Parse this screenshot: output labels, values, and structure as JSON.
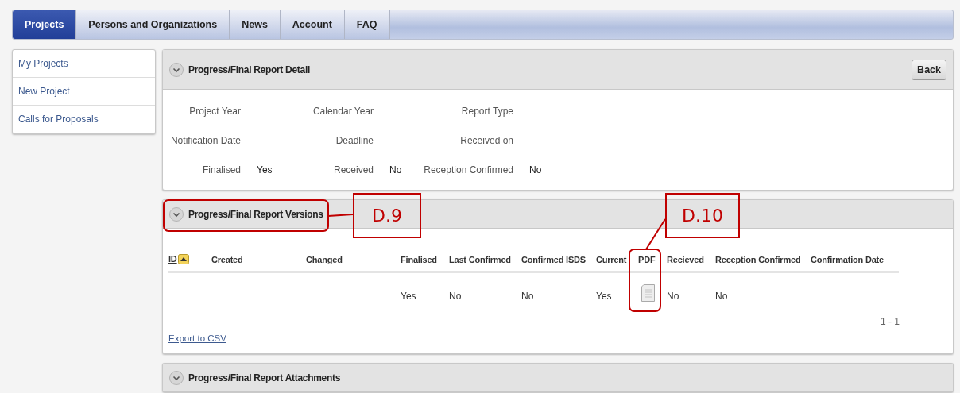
{
  "tabs": [
    {
      "label": "Projects",
      "selected": true
    },
    {
      "label": "Persons and Organizations",
      "selected": false
    },
    {
      "label": "News",
      "selected": false
    },
    {
      "label": "Account",
      "selected": false
    },
    {
      "label": "FAQ",
      "selected": false
    }
  ],
  "sidebar": {
    "items": [
      {
        "label": "My Projects"
      },
      {
        "label": "New Project"
      },
      {
        "label": "Calls for Proposals"
      }
    ]
  },
  "detail_panel": {
    "title": "Progress/Final Report Detail",
    "back_button": "Back",
    "rows": [
      [
        {
          "label": "Project Year"
        },
        {
          "label": "Calendar Year"
        },
        {
          "label": "Report Type"
        }
      ],
      [
        {
          "label": "Notification Date"
        },
        {
          "label": "Deadline"
        },
        {
          "label": "Received on"
        }
      ],
      [
        {
          "label": "Finalised",
          "value": "Yes"
        },
        {
          "label": "Received",
          "value": "No"
        },
        {
          "label": "Reception Confirmed",
          "value": "No"
        }
      ]
    ]
  },
  "versions_panel": {
    "title": "Progress/Final Report Versions",
    "table": {
      "columns": [
        {
          "label": "ID",
          "link": true,
          "sorted": true
        },
        {
          "label": "Created",
          "link": true,
          "sorted": false
        },
        {
          "label": "Changed",
          "link": true,
          "sorted": false
        },
        {
          "label": "Finalised",
          "link": true,
          "sorted": false
        },
        {
          "label": "Last Confirmed",
          "link": true,
          "sorted": false
        },
        {
          "label": "Confirmed ISDS",
          "link": true,
          "sorted": false
        },
        {
          "label": "Current",
          "link": true,
          "sorted": false
        },
        {
          "label": "PDF",
          "link": false,
          "sorted": false
        },
        {
          "label": "Recieved",
          "link": true,
          "sorted": false
        },
        {
          "label": "Reception Confirmed",
          "link": true,
          "sorted": false
        },
        {
          "label": "Confirmation Date",
          "link": true,
          "sorted": false
        }
      ],
      "rows": [
        {
          "cells": [
            {
              "kind": "empty"
            },
            {
              "kind": "empty"
            },
            {
              "kind": "empty"
            },
            {
              "kind": "text",
              "text": "Yes"
            },
            {
              "kind": "text",
              "text": "No"
            },
            {
              "kind": "text",
              "text": "No"
            },
            {
              "kind": "text",
              "text": "Yes"
            },
            {
              "kind": "document"
            },
            {
              "kind": "text",
              "text": "No"
            },
            {
              "kind": "text",
              "text": "No"
            },
            {
              "kind": "empty"
            }
          ]
        }
      ],
      "pagination": "1 - 1"
    },
    "export_link": "Export to CSV"
  },
  "attachments_panel": {
    "title": "Progress/Final Report Attachments"
  },
  "annotations": [
    {
      "label": "D.9"
    },
    {
      "label": "D.10"
    }
  ]
}
